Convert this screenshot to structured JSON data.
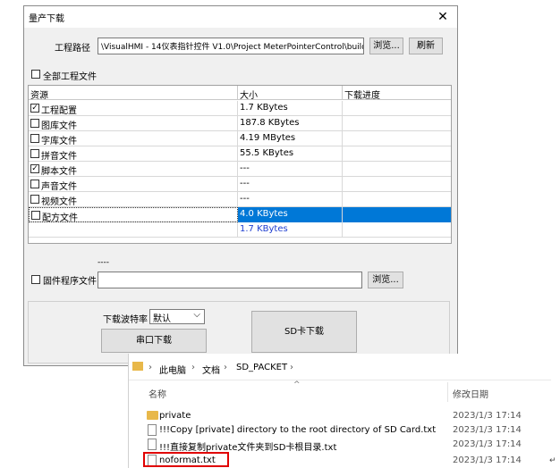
{
  "dialog": {
    "title": "量产下载",
    "close_glyph": "✕",
    "project_path_label": "工程路径",
    "project_path_value": "\\VisualHMI - 14仪表指针控件 V1.0\\Project MeterPointerControl\\build\\private",
    "browse_label": "浏览...",
    "refresh_label": "刷新",
    "all_files_label": "全部工程文件",
    "all_files_checked": false,
    "table": {
      "headers": [
        "资源",
        "大小",
        "下载进度"
      ],
      "rows": [
        {
          "name": "工程配置",
          "checked": true,
          "size": "1.7 KBytes",
          "progress": "",
          "selected": false
        },
        {
          "name": "图库文件",
          "checked": false,
          "size": "187.8 KBytes",
          "progress": "",
          "selected": false
        },
        {
          "name": "字库文件",
          "checked": false,
          "size": "4.19 MBytes",
          "progress": "",
          "selected": false
        },
        {
          "name": "拼音文件",
          "checked": false,
          "size": "55.5 KBytes",
          "progress": "",
          "selected": false
        },
        {
          "name": "脚本文件",
          "checked": true,
          "size": "---",
          "progress": "",
          "selected": false
        },
        {
          "name": "声音文件",
          "checked": false,
          "size": "---",
          "progress": "",
          "selected": false
        },
        {
          "name": "视频文件",
          "checked": false,
          "size": "---",
          "progress": "",
          "selected": false
        },
        {
          "name": "配方文件",
          "checked": false,
          "size": "4.0 KBytes",
          "progress": "",
          "selected": true
        }
      ],
      "total": "1.7 KBytes"
    },
    "dashes": "----",
    "firmware_label": "固件程序文件",
    "firmware_checked": false,
    "firmware_value": "",
    "firmware_browse_label": "浏览...",
    "baud_label": "下载波特率",
    "baud_value": "默认",
    "serial_download_label": "串口下载",
    "sd_download_label": "SD卡下载",
    "check_glyph": "✓",
    "dropdown_glyph": "⌵"
  },
  "explorer": {
    "breadcrumb": [
      "此电脑",
      "文档",
      "SD_PACKET"
    ],
    "separator": "›",
    "sort_glyph": "^",
    "col_name": "名称",
    "col_date": "修改日期",
    "files": [
      {
        "name": "private",
        "kind": "folder",
        "date": "2023/1/3 17:14",
        "highlight": false
      },
      {
        "name": "!!!Copy [private] directory to the root directory of  SD Card.txt",
        "kind": "doc",
        "date": "2023/1/3 17:14",
        "highlight": false
      },
      {
        "name": "!!!直接复制private文件夹到SD卡根目录.txt",
        "kind": "doc",
        "date": "2023/1/3 17:14",
        "highlight": false
      },
      {
        "name": "noformat.txt",
        "kind": "doc",
        "date": "2023/1/3 17:14",
        "highlight": true
      }
    ],
    "highlight_color": "#e00000",
    "return_mark": "↵"
  }
}
